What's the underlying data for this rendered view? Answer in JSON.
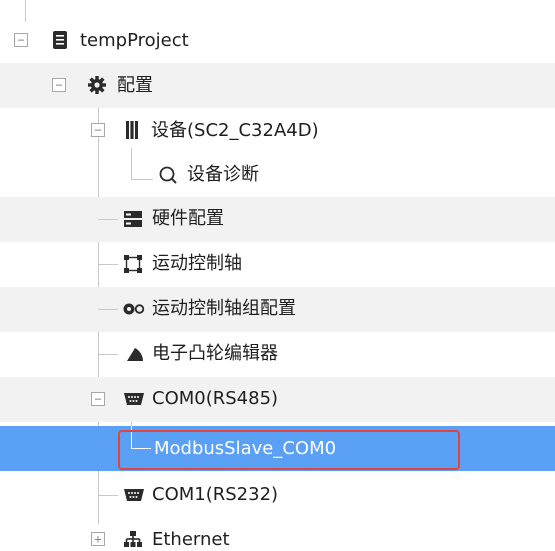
{
  "tree": {
    "project": {
      "label": "tempProject",
      "expander": "−",
      "icon": "document-icon"
    },
    "config": {
      "label": "配置",
      "expander": "−",
      "icon": "gear-icon"
    },
    "device": {
      "label": "设备(SC2_C32A4D)",
      "expander": "−",
      "icon": "device-icon"
    },
    "diagnosis": {
      "label": "设备诊断",
      "icon": "search-icon"
    },
    "hardware": {
      "label": "硬件配置",
      "icon": "hardware-icon"
    },
    "motion_axis": {
      "label": "运动控制轴",
      "icon": "axis-icon"
    },
    "axis_group": {
      "label": "运动控制轴组配置",
      "icon": "axis-group-icon"
    },
    "cam_editor": {
      "label": "电子凸轮编辑器",
      "icon": "cam-icon"
    },
    "com0": {
      "label": "COM0(RS485)",
      "expander": "−",
      "icon": "serial-port-icon"
    },
    "modbus_slave": {
      "label": "ModbusSlave_COM0",
      "selected": true
    },
    "com1": {
      "label": "COM1(RS232)",
      "icon": "serial-port-icon"
    },
    "ethernet": {
      "label": "Ethernet",
      "expander": "+",
      "icon": "network-icon"
    }
  },
  "colors": {
    "selection": "#5aa0f4",
    "highlight_border": "#e0463e",
    "alt_row": "#f2f2f2"
  }
}
